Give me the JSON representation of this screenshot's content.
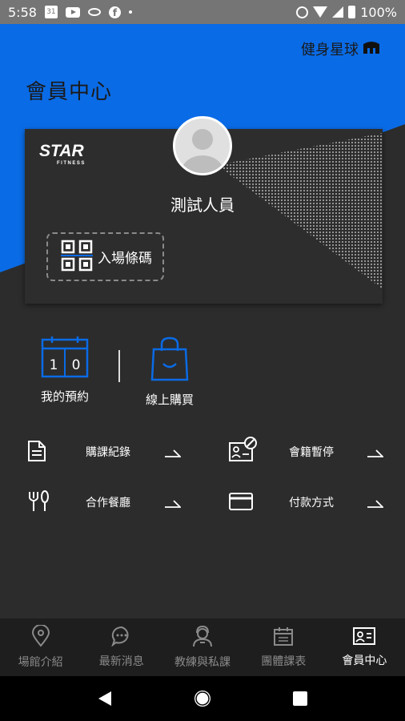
{
  "status_bar": {
    "time": "5:58",
    "calendar_day": "31",
    "battery": "100%",
    "icons": [
      "calendar-icon",
      "youtube-icon",
      "eye-icon",
      "facebook-icon",
      "dot-icon",
      "alarm-icon",
      "wifi-icon",
      "signal-icon",
      "battery-icon"
    ]
  },
  "header": {
    "brand": "健身星球",
    "title": "會員中心"
  },
  "card": {
    "logo_text": "STAR",
    "logo_sub": "FITNESS",
    "member_name": "測試人員",
    "barcode_label": "入場條碼"
  },
  "quick_actions": [
    {
      "label": "我的預約",
      "icon": "calendar-icon",
      "calendar_digits": [
        "1",
        "0"
      ]
    },
    {
      "label": "線上購買",
      "icon": "shopping-bag-icon"
    }
  ],
  "menu": [
    {
      "label": "購課紀錄",
      "icon": "document-icon"
    },
    {
      "label": "會籍暫停",
      "icon": "member-card-pause-icon"
    },
    {
      "label": "合作餐廳",
      "icon": "fork-knife-icon"
    },
    {
      "label": "付款方式",
      "icon": "credit-card-icon"
    }
  ],
  "bottom_nav": [
    {
      "label": "場館介紹",
      "icon": "location-pin-icon",
      "active": false
    },
    {
      "label": "最新消息",
      "icon": "chat-bubble-icon",
      "active": false
    },
    {
      "label": "教練與私課",
      "icon": "coach-icon",
      "active": false
    },
    {
      "label": "團體課表",
      "icon": "schedule-icon",
      "active": false
    },
    {
      "label": "會員中心",
      "icon": "member-id-icon",
      "active": true
    }
  ],
  "colors": {
    "accent_blue": "#0a6be6",
    "background": "#2c2c2c",
    "card": "#2d2d2d",
    "nav_bg": "#1e1e1e"
  }
}
